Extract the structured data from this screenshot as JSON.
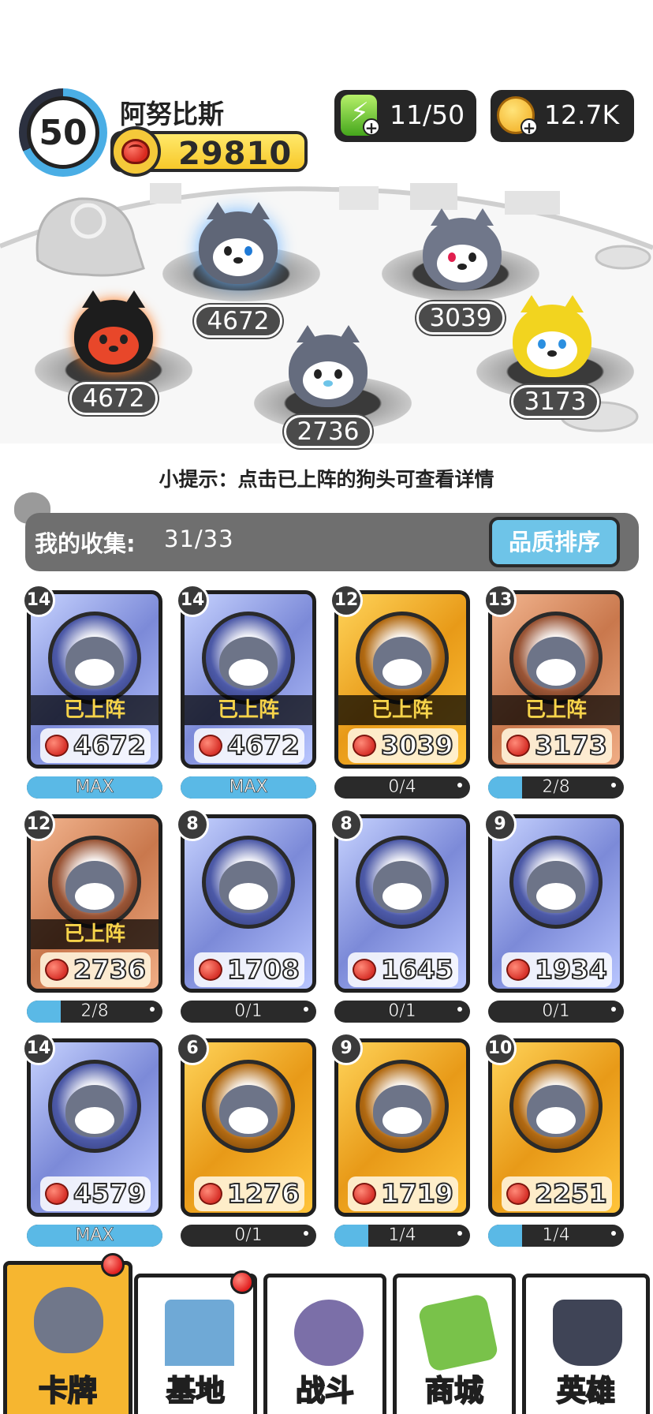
{
  "player": {
    "level": "50",
    "name": "阿努比斯",
    "power": "29810"
  },
  "resources": {
    "energy": "11/50",
    "coins": "12.7K"
  },
  "battlefield": [
    {
      "power": "4672"
    },
    {
      "power": "3039"
    },
    {
      "power": "4672"
    },
    {
      "power": "2736"
    },
    {
      "power": "3173"
    }
  ],
  "hint": "小提示：点击已上阵的狗头可查看详情",
  "collection": {
    "title": "我的收集:",
    "count": "31/33",
    "sort_label": "品质排序"
  },
  "deployed_label": "已上阵",
  "cards": [
    {
      "level": "14",
      "power": "4672",
      "rarity": "blue",
      "deployed": true,
      "progress": "MAX",
      "fill": 1
    },
    {
      "level": "14",
      "power": "4672",
      "rarity": "blue",
      "deployed": true,
      "progress": "MAX",
      "fill": 1
    },
    {
      "level": "12",
      "power": "3039",
      "rarity": "gold",
      "deployed": true,
      "progress": "0/4",
      "fill": 0
    },
    {
      "level": "13",
      "power": "3173",
      "rarity": "bronze",
      "deployed": true,
      "progress": "2/8",
      "fill": 0.25
    },
    {
      "level": "12",
      "power": "2736",
      "rarity": "bronze",
      "deployed": true,
      "progress": "2/8",
      "fill": 0.25
    },
    {
      "level": "8",
      "power": "1708",
      "rarity": "blue",
      "deployed": false,
      "progress": "0/1",
      "fill": 0
    },
    {
      "level": "8",
      "power": "1645",
      "rarity": "blue",
      "deployed": false,
      "progress": "0/1",
      "fill": 0
    },
    {
      "level": "9",
      "power": "1934",
      "rarity": "blue",
      "deployed": false,
      "progress": "0/1",
      "fill": 0
    },
    {
      "level": "14",
      "power": "4579",
      "rarity": "blue",
      "deployed": false,
      "progress": "MAX",
      "fill": 1
    },
    {
      "level": "6",
      "power": "1276",
      "rarity": "gold",
      "deployed": false,
      "progress": "0/1",
      "fill": 0
    },
    {
      "level": "9",
      "power": "1719",
      "rarity": "gold",
      "deployed": false,
      "progress": "1/4",
      "fill": 0.25
    },
    {
      "level": "10",
      "power": "2251",
      "rarity": "gold",
      "deployed": false,
      "progress": "1/4",
      "fill": 0.25
    }
  ],
  "nav": [
    {
      "label": "卡牌",
      "icon": "dog-head-icon",
      "active": true,
      "badge": true
    },
    {
      "label": "基地",
      "icon": "castle-icon",
      "active": false,
      "badge": true
    },
    {
      "label": "战斗",
      "icon": "paw-icon",
      "active": false,
      "badge": false
    },
    {
      "label": "商城",
      "icon": "money-icon",
      "active": false,
      "badge": false
    },
    {
      "label": "英雄",
      "icon": "hero-dog-icon",
      "active": false,
      "badge": false
    }
  ],
  "colors": {
    "blue_card": "#7c8ad8",
    "gold_card": "#e89a18",
    "bronze_card": "#c9784d",
    "progress_fill": "#5ab9e6",
    "active_tab": "#f6b630"
  }
}
